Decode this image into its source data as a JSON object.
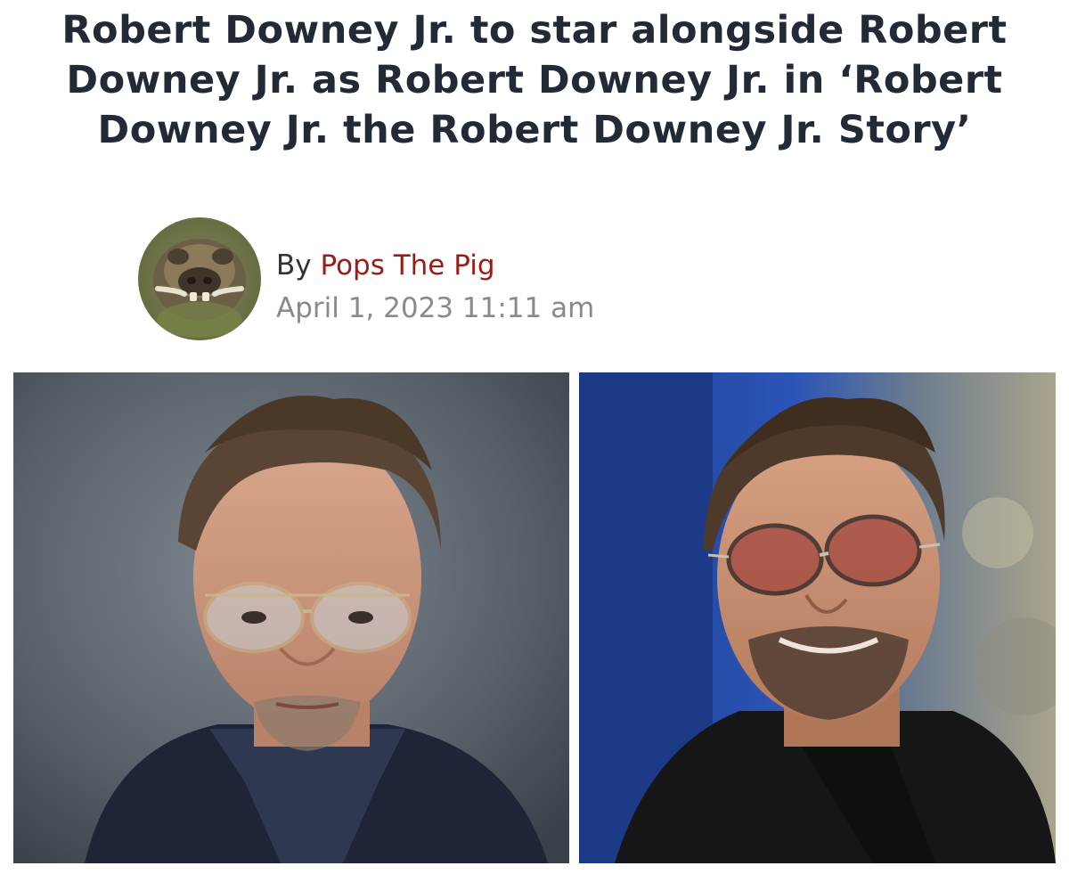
{
  "article": {
    "headline": "Robert Downey Jr. to star alongside Robert Downey Jr. as Robert Downey Jr. in ‘Robert Downey Jr. the Robert Downey Jr. Story’",
    "by_label": "By",
    "author": "Pops The Pig",
    "date": "April 1, 2023 11:11 am"
  },
  "colors": {
    "headline": "#222a35",
    "author_link": "#9b1b17",
    "date": "#8a8a8a"
  },
  "icons": {
    "avatar": "boar-photo",
    "photo_left": "portrait-photo-grey-backdrop",
    "photo_right": "portrait-photo-blue-backdrop"
  }
}
